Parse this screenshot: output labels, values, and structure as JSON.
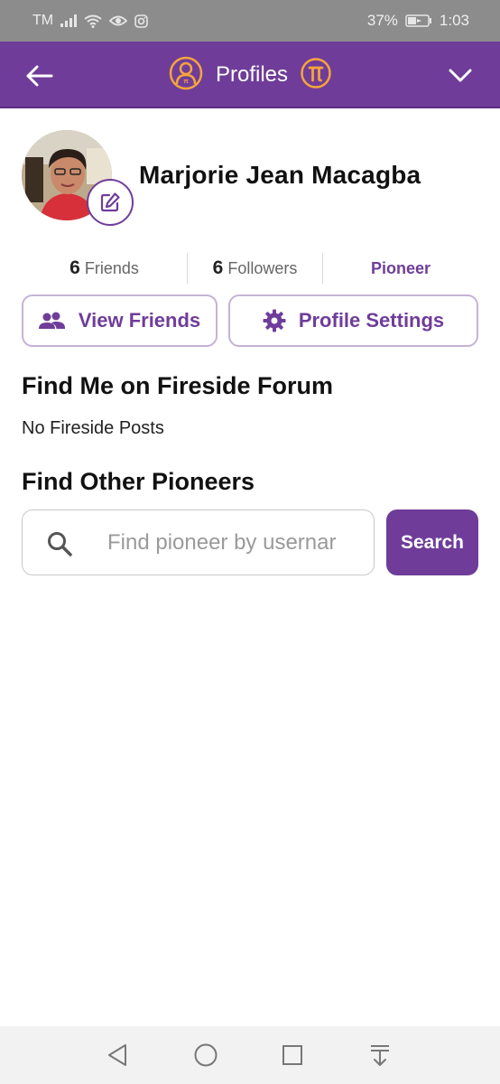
{
  "status_bar": {
    "carrier": "TM",
    "battery": "37%",
    "time": "1:03",
    "icons": [
      "signal-icon",
      "wifi-icon",
      "eye-icon",
      "instagram-icon",
      "battery-icon"
    ]
  },
  "header": {
    "title": "Profiles",
    "icons": [
      "back-arrow-icon",
      "profile-circle-icon",
      "pi-coin-icon",
      "chevron-down-icon"
    ],
    "accent_color": "#6f3d99",
    "icon_color": "#f6a53b"
  },
  "profile": {
    "name": "Marjorie Jean Macagba",
    "edit_icon": "pencil-edit-icon"
  },
  "stats": {
    "friends_count": "6",
    "friends_label": "Friends",
    "followers_count": "6",
    "followers_label": "Followers",
    "role": "Pioneer"
  },
  "actions": {
    "view_friends": "View Friends",
    "view_friends_icon": "people-icon",
    "profile_settings": "Profile Settings",
    "profile_settings_icon": "gear-icon"
  },
  "fireside": {
    "title": "Find Me on Fireside Forum",
    "empty_text": "No Fireside Posts"
  },
  "find_pioneers": {
    "title": "Find Other Pioneers",
    "search_placeholder": "Find pioneer by usernar",
    "search_value": "",
    "search_button": "Search"
  },
  "nav_bar": {
    "icons": [
      "back-triangle-icon",
      "home-circle-icon",
      "recents-square-icon",
      "notification-pull-icon"
    ]
  }
}
